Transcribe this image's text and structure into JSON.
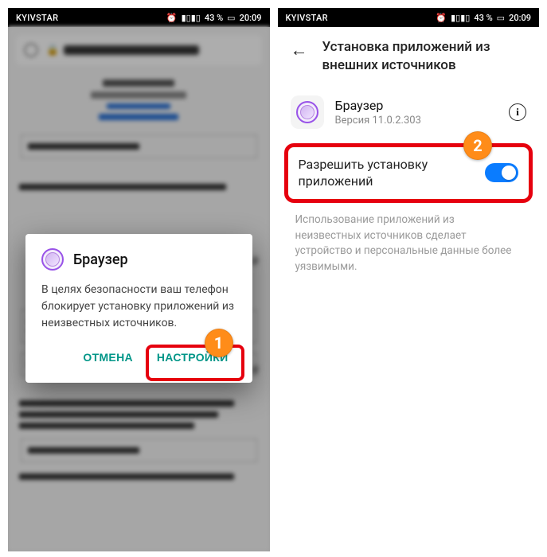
{
  "status_bar": {
    "carrier": "KYIVSTAR",
    "alarm_icon": "⏰",
    "vib_icon": "▮▯▮▯",
    "battery_text": "43 %",
    "battery_icon": "▭",
    "time": "20:09"
  },
  "left": {
    "dialog": {
      "app_name": "Браузер",
      "message": "В целях безопасности ваш телефон блокирует установку приложений из неизвестных источников.",
      "cancel": "ОТМЕНА",
      "settings": "НАСТРОЙКИ"
    },
    "step_number": "1"
  },
  "right": {
    "header_title": "Установка приложений из внешних источников",
    "app": {
      "name": "Браузер",
      "version": "Версия 11.0.2.303"
    },
    "toggle": {
      "label": "Разрешить установку приложений",
      "state": "on"
    },
    "warning": "Использование приложений из неизвестных источников сделает устройство и персональные данные более уязвимыми.",
    "step_number": "2"
  }
}
